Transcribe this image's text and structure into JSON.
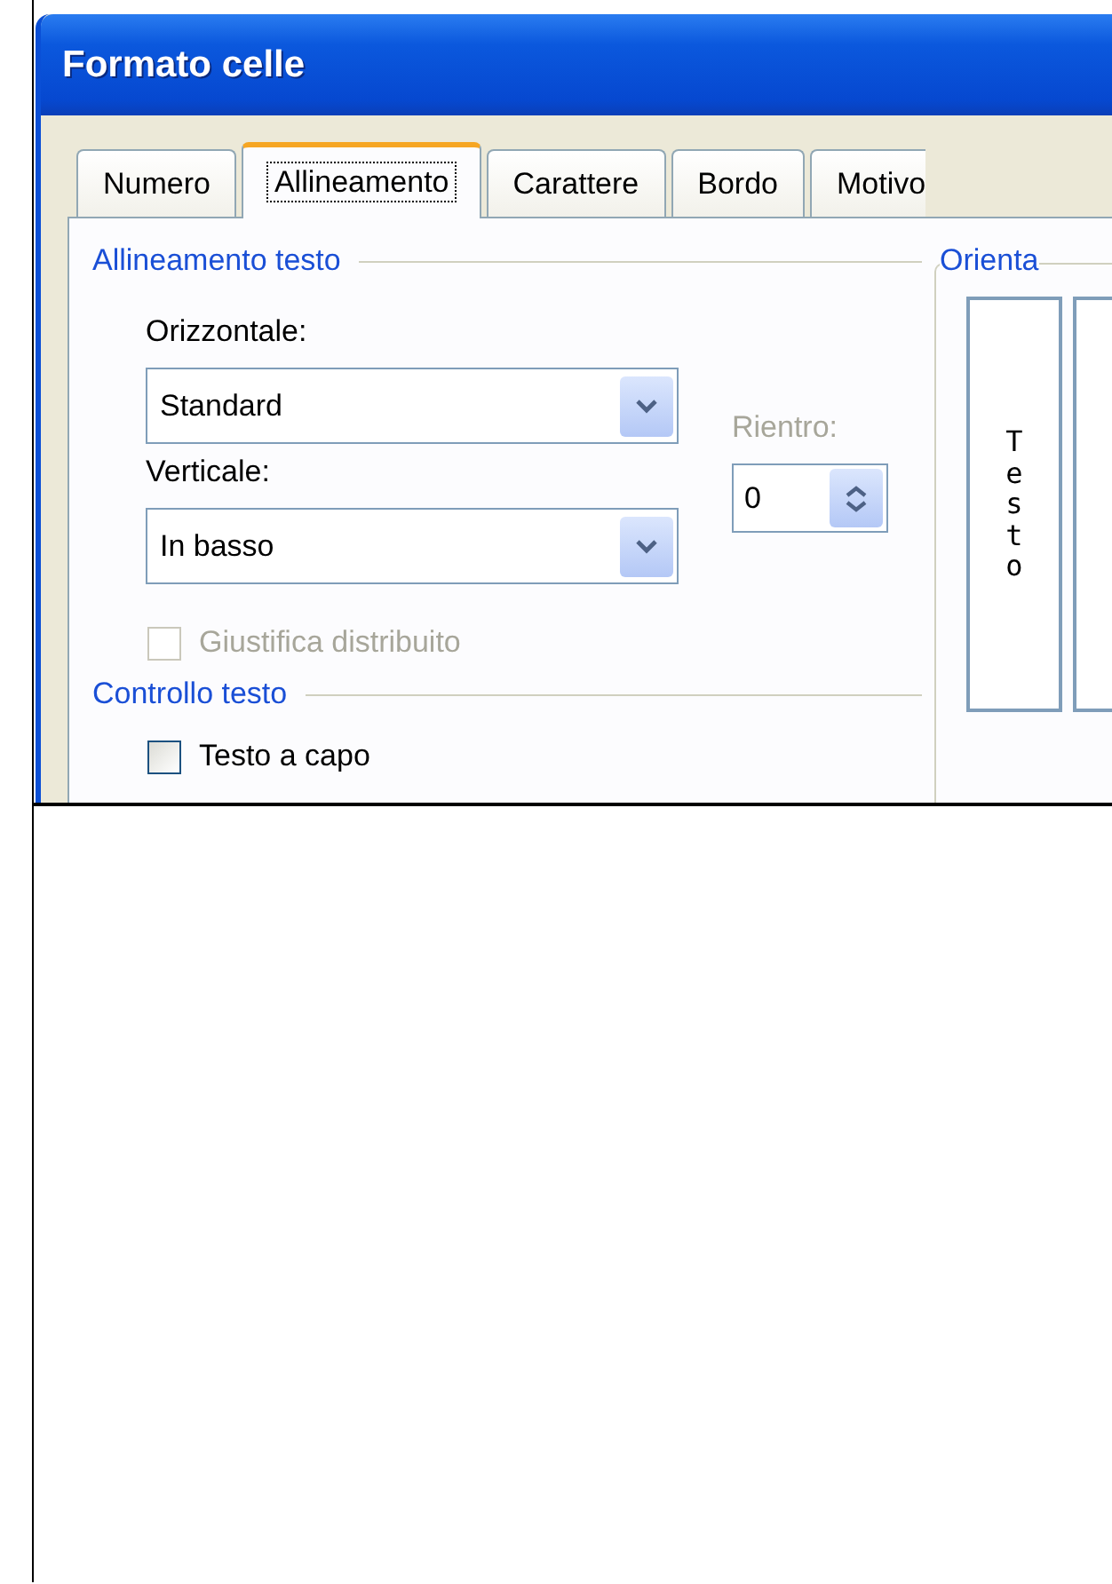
{
  "window": {
    "title": "Formato celle"
  },
  "tabs": [
    {
      "label": "Numero",
      "selected": false
    },
    {
      "label": "Allineamento",
      "selected": true
    },
    {
      "label": "Carattere",
      "selected": false
    },
    {
      "label": "Bordo",
      "selected": false
    },
    {
      "label": "Motivo",
      "selected": false
    }
  ],
  "text_alignment": {
    "heading": "Allineamento testo",
    "horizontal": {
      "label": "Orizzontale:",
      "value": "Standard"
    },
    "vertical": {
      "label": "Verticale:",
      "value": "In basso"
    },
    "indent": {
      "label": "Rientro:",
      "value": "0",
      "disabled": true
    },
    "options": [
      {
        "label": "Giustifica distribuito",
        "checked": false,
        "disabled": true
      }
    ]
  },
  "text_control": {
    "heading": "Controllo testo",
    "options": [
      {
        "label": "Testo a capo",
        "checked": false,
        "disabled": false
      }
    ]
  },
  "orientation": {
    "heading": "Orienta",
    "vertical_text": "Testo"
  }
}
